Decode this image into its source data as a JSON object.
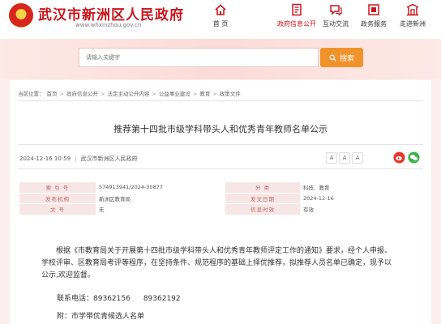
{
  "header": {
    "site_title": "武汉市新洲区人民政府",
    "site_url": "www.whxinzhou.gov.cn",
    "nav": [
      {
        "label": "首 页",
        "icon": "home-icon"
      },
      {
        "label": "政府信息公开",
        "icon": "document-icon",
        "active": true
      },
      {
        "label": "互动交流",
        "icon": "chat-icon"
      },
      {
        "label": "政务服务",
        "icon": "service-icon"
      },
      {
        "label": "走进新洲",
        "icon": "gate-icon"
      }
    ],
    "colors": {
      "brand": "#c8161d",
      "search_button": "#f0932b"
    }
  },
  "search": {
    "placeholder": "请输入关键字",
    "button_label": "搜索"
  },
  "breadcrumb": {
    "prefix": "当前位置：",
    "items": [
      "首页",
      "政府信息公开",
      "法定主动公开内容",
      "公益事业建设",
      "教育",
      "政策文件"
    ]
  },
  "article": {
    "title": "推荐第十四批市级学科带头人和优秀青年教师名单公示",
    "datetime": "2024-12-16 10:59",
    "source": "武汉市新洲区人民政府",
    "font_controls": [
      "A",
      "A",
      "A"
    ]
  },
  "info_table": {
    "rows": [
      {
        "k1": "索 引 号",
        "v1": "574913941/2024-30877",
        "k2": "分 类",
        "v2": "科技、教育"
      },
      {
        "k1": "发布机构",
        "v1": "新洲区教育局",
        "k2": "发文日期",
        "v2": "2024-12-16"
      },
      {
        "k1": "文 号",
        "v1": "无",
        "k2": "信息时效",
        "v2": "有效"
      }
    ]
  },
  "content": {
    "paragraph": "根据《市教育局关于开展第十四批市级学科带头人和优秀青年教师评定工作的通知》要求，经个人申报、学校评审、区教育局考评等程序，在坚持条件、规范程序的基础上择优推荐，拟推荐人员名单已确定，现予以公示,欢迎监督。",
    "contact_label": "联系电话：",
    "phone1": "89362156",
    "phone2": "89362192",
    "attachment": "附：市学带优青候选人名单"
  }
}
